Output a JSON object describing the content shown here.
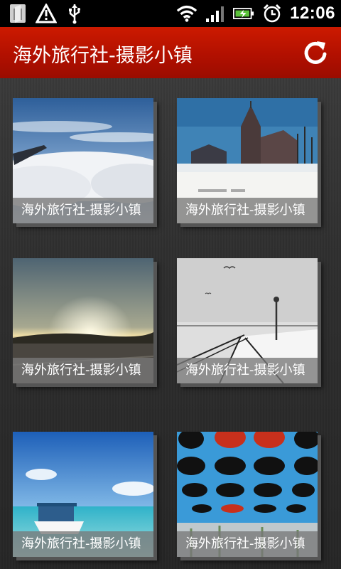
{
  "status_bar": {
    "time": "12:06",
    "icons": [
      "app-notification-icon",
      "warning-icon",
      "usb-icon",
      "wifi-icon",
      "signal-icon",
      "battery-charging-icon",
      "alarm-icon"
    ]
  },
  "header": {
    "title": "海外旅行社-摄影小镇",
    "refresh_icon": "refresh-icon",
    "background": "#b21000"
  },
  "gallery": {
    "items": [
      {
        "caption": "海外旅行社-摄影小镇"
      },
      {
        "caption": "海外旅行社-摄影小镇"
      },
      {
        "caption": "海外旅行社-摄影小镇"
      },
      {
        "caption": "海外旅行社-摄影小镇"
      },
      {
        "caption": "海外旅行社-摄影小镇"
      },
      {
        "caption": "海外旅行社-摄影小镇"
      }
    ]
  }
}
